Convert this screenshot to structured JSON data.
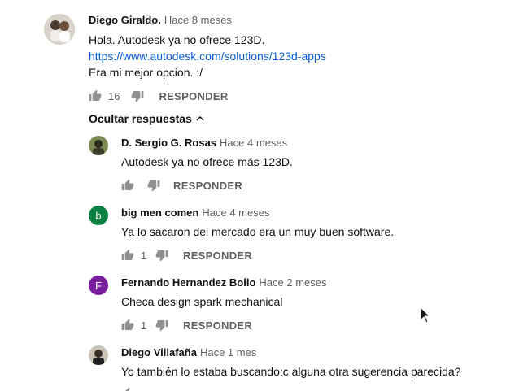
{
  "comment": {
    "author": "Diego Giraldo.",
    "time": "Hace 8 meses",
    "line1": "Hola.  Autodesk ya no ofrece 123D.",
    "link": "https://www.autodesk.com/solutions/123d-apps",
    "line3": "Era mi mejor opcion. :/",
    "likes": "16",
    "reply_label": "RESPONDER"
  },
  "replies_toggle": "Ocultar respuestas",
  "replies": [
    {
      "author": "D. Sergio G. Rosas",
      "time": "Hace 4 meses",
      "text": "Autodesk ya no ofrece más 123D.",
      "likes": "",
      "reply_label": "RESPONDER"
    },
    {
      "author": "big men comen",
      "time": "Hace 4 meses",
      "text": "Ya lo sacaron del mercado era un muy buen software.",
      "likes": "1",
      "reply_label": "RESPONDER",
      "avatar_letter": "b",
      "avatar_color": "#0b8043"
    },
    {
      "author": "Fernando Hernandez Bolio",
      "time": "Hace 2 meses",
      "text": "Checa design spark mechanical",
      "likes": "1",
      "reply_label": "RESPONDER",
      "avatar_letter": "F",
      "avatar_color": "#7b1fa2"
    },
    {
      "author": "Diego Villafaña",
      "time": "Hace 1 mes",
      "text": "Yo también lo estaba buscando:c alguna otra sugerencia parecida?"
    }
  ]
}
